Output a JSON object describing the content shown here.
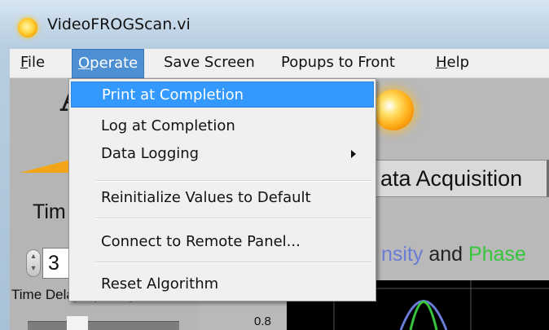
{
  "window": {
    "title": "VideoFROGScan.vi"
  },
  "menubar": {
    "items": [
      {
        "label": "File",
        "mnemonic": "F"
      },
      {
        "label": "Operate",
        "mnemonic": "O"
      },
      {
        "label": "Save Screen"
      },
      {
        "label": "Popups to Front"
      },
      {
        "label": "Help",
        "mnemonic": "H"
      }
    ],
    "active": "Operate"
  },
  "dropdown": {
    "items": [
      {
        "label": "Print at Completion",
        "highlighted": true
      },
      {
        "label": "Log at Completion"
      },
      {
        "label": "Data Logging",
        "submenu": true
      },
      {
        "label": "Reinitialize Values to Default"
      },
      {
        "label": "Connect to Remote Panel..."
      },
      {
        "label": "Reset Algorithm"
      }
    ]
  },
  "panel": {
    "logo_letter": "A",
    "tab_label": "Data Acquisition",
    "tab_visible_text": "ata Acquisition",
    "plot_title": {
      "part1": "nsity",
      "part2": " and ",
      "part3": "Phase"
    },
    "time_label": "Tim",
    "numeric_value": "3",
    "time_delay_label": "Time Delay Spacing",
    "y_tick": "0.8",
    "colors": {
      "intensity": "#6a7bd8",
      "phase": "#35c63c",
      "accent": "#3399ff"
    }
  }
}
